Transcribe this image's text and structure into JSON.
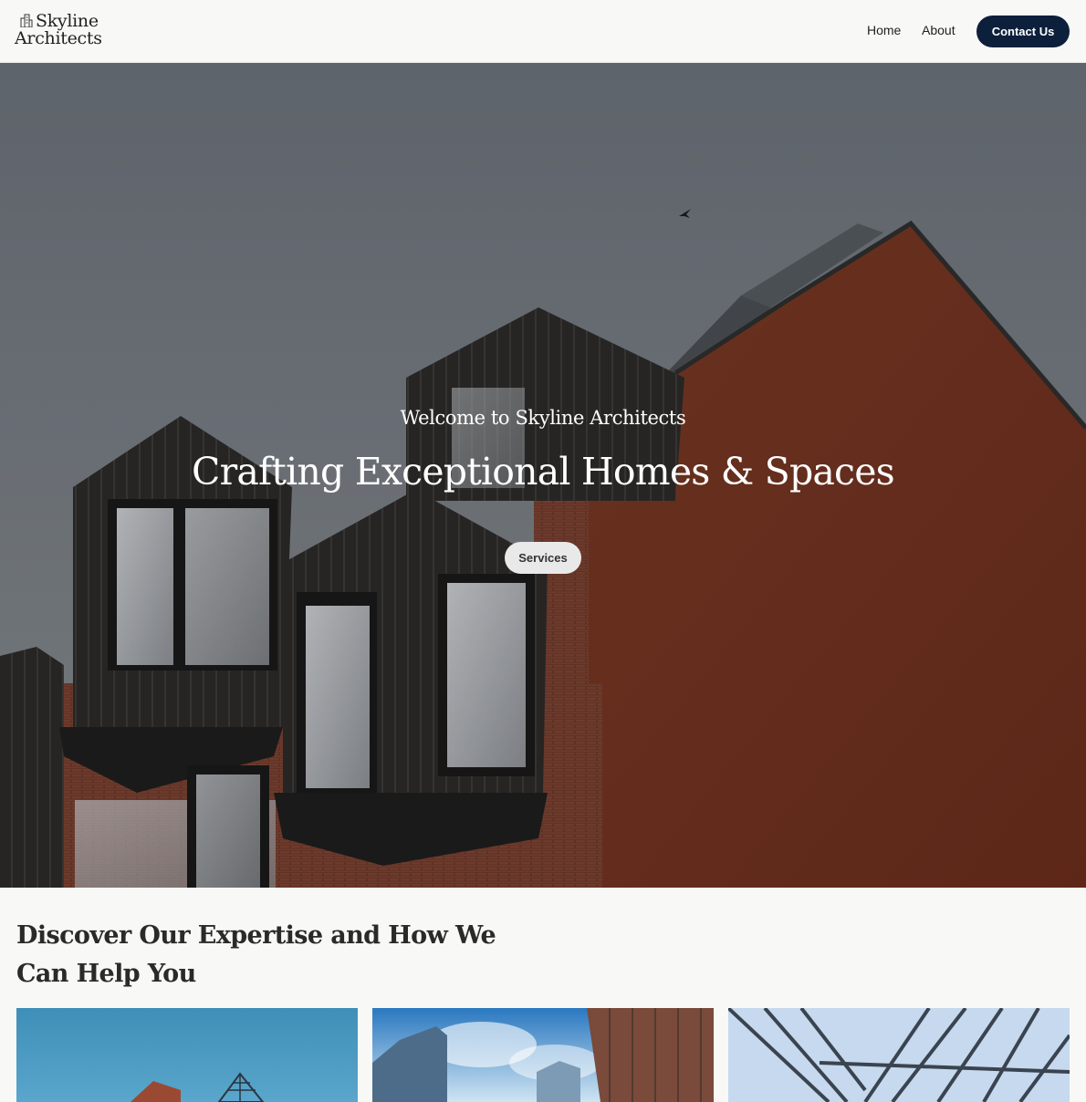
{
  "header": {
    "logo": {
      "line1": "Skyline",
      "line2": "Architects"
    },
    "nav": {
      "home": "Home",
      "about": "About"
    },
    "contact_button": "Contact Us"
  },
  "hero": {
    "eyebrow": "Welcome to Skyline Architects",
    "title": "Crafting Exceptional Homes & Spaces",
    "services_button": "Services"
  },
  "expertise": {
    "heading": "Discover Our Expertise and How We Can Help You"
  },
  "colors": {
    "page_bg": "#f8f9f6",
    "accent": "#0c1f3b",
    "text": "#2a2a2a"
  }
}
